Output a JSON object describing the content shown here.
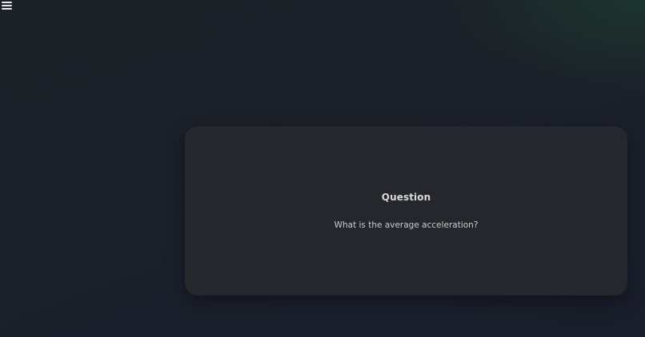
{
  "header": {
    "menu_icon": "hamburger-menu-icon"
  },
  "card": {
    "title": "Question",
    "question": "What is the average acceleration?"
  }
}
